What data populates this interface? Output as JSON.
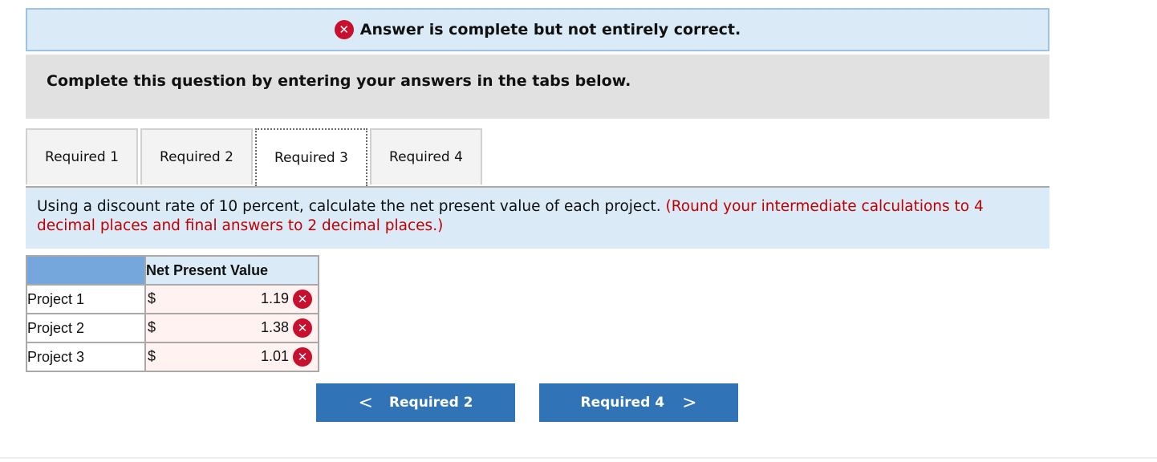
{
  "banner": {
    "icon": "x-circle-icon",
    "text": "Answer is complete but not entirely correct."
  },
  "instruction": "Complete this question by entering your answers in the tabs below.",
  "tabs": [
    {
      "label": "Required 1",
      "active": false
    },
    {
      "label": "Required 2",
      "active": false
    },
    {
      "label": "Required 3",
      "active": true
    },
    {
      "label": "Required 4",
      "active": false
    }
  ],
  "question": {
    "text": "Using a discount rate of 10 percent, calculate the net present value of each project.",
    "note": "(Round your intermediate calculations to 4 decimal places and final answers to 2 decimal places.)"
  },
  "table": {
    "column_header": "Net Present Value",
    "rows": [
      {
        "label": "Project 1",
        "currency": "$",
        "value": "1.19",
        "status": "incorrect"
      },
      {
        "label": "Project 2",
        "currency": "$",
        "value": "1.38",
        "status": "incorrect"
      },
      {
        "label": "Project 3",
        "currency": "$",
        "value": "1.01",
        "status": "incorrect"
      }
    ]
  },
  "nav": {
    "prev_label": "Required 2",
    "next_label": "Required 4",
    "prev_icon": "chevron-left-icon",
    "next_icon": "chevron-right-icon"
  },
  "colors": {
    "error": "#c8102e",
    "button": "#3173b7",
    "banner_bg": "#daeaf7",
    "header_bg": "#76a7dc"
  }
}
